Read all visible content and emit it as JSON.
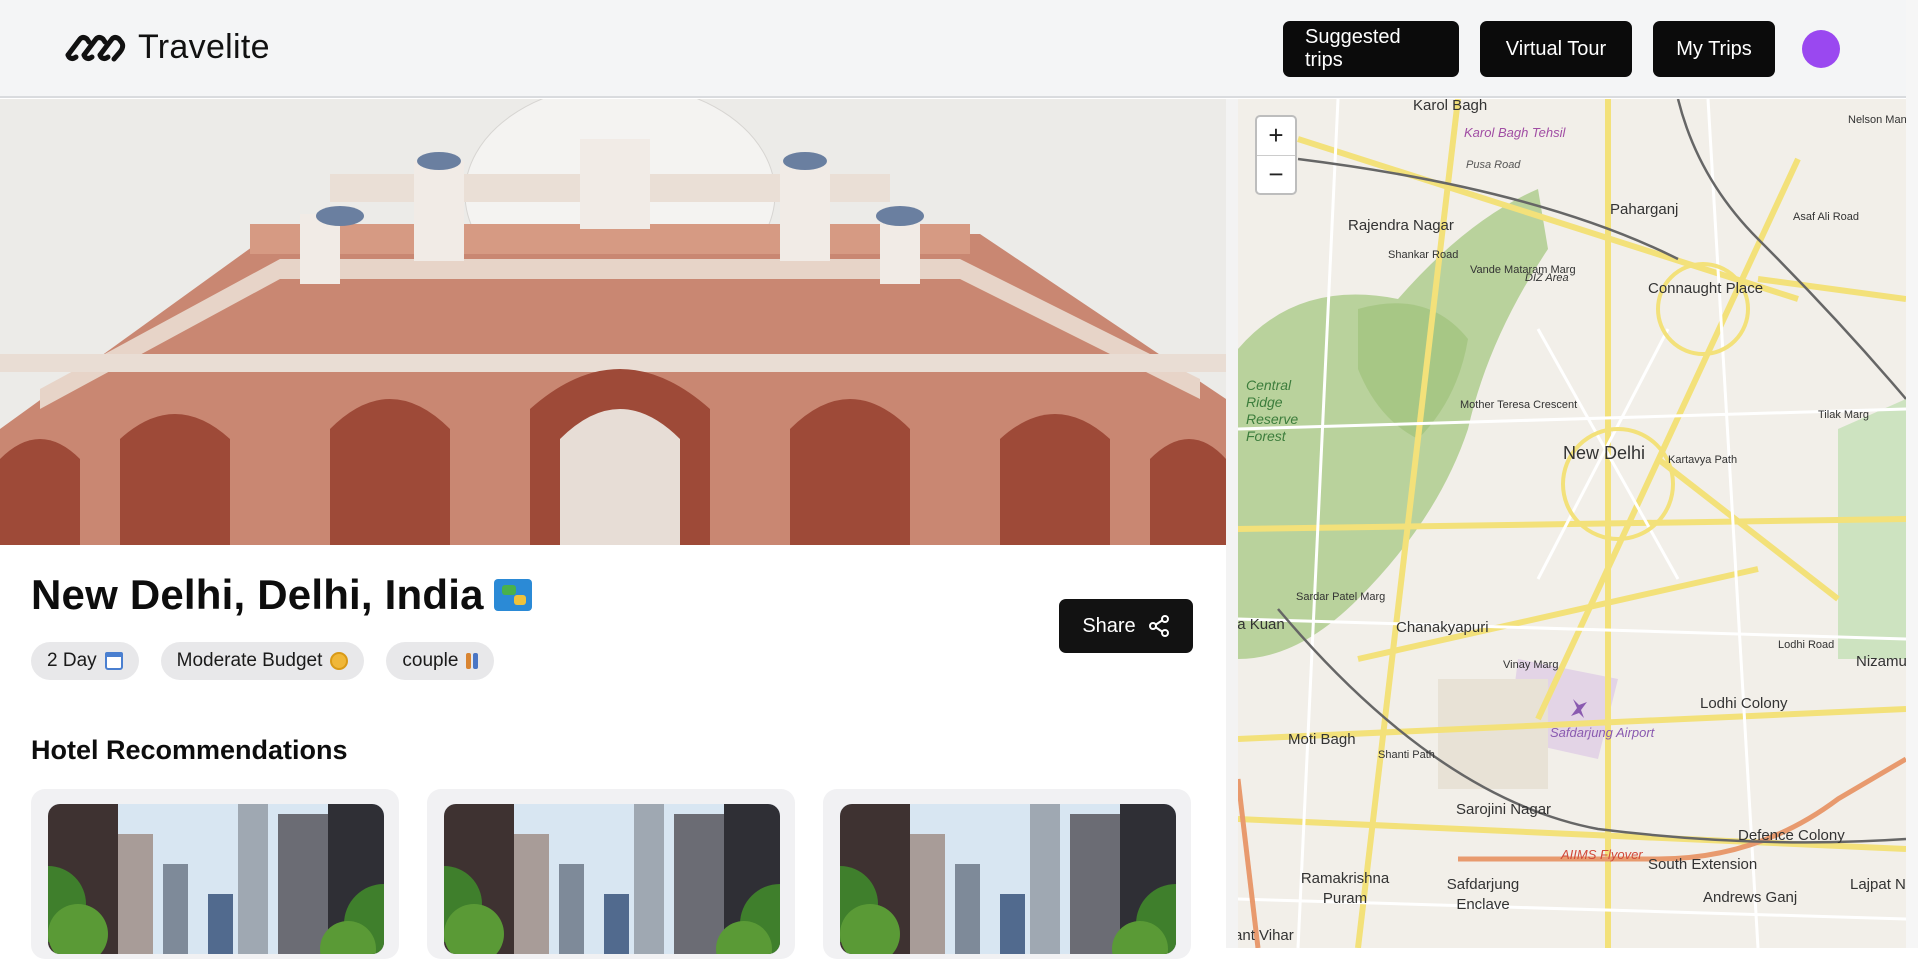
{
  "header": {
    "brand": "Travelite",
    "nav": [
      "Suggested trips",
      "Virtual Tour",
      "My Trips"
    ]
  },
  "trip": {
    "title": "New Delhi, Delhi, India",
    "chips": [
      "2 Day",
      "Moderate Budget",
      "couple"
    ],
    "share_label": "Share"
  },
  "hotels": {
    "section_title": "Hotel Recommendations",
    "cards": [
      {},
      {},
      {}
    ]
  },
  "map": {
    "zoom_in": "+",
    "zoom_out": "−",
    "labels": [
      "Karol Bagh",
      "Karol Bagh Tehsil",
      "Pusa Road",
      "Paharganj",
      "Asaf Ali Road",
      "Rajendra Nagar",
      "Shankar Road",
      "Vande Mataram Marg",
      "DIZ Area",
      "Connaught Place",
      "Central Ridge Reserve Forest",
      "Mother Teresa Crescent",
      "New Delhi",
      "Kartavya Path",
      "Tilak Marg",
      "Sardar Patel Marg",
      "Chanakyapuri",
      "Lodhi Road",
      "Nizamuddin",
      "Lodhi Colony",
      "Safdarjung Airport",
      "Moti Bagh",
      "Shanti Path",
      "Sarojini Nagar",
      "AIIMS Flyover",
      "Defence Colony",
      "South Extension",
      "Ramakrishna Puram",
      "Safdarjung Enclave",
      "Andrews Ganj",
      "Lajpat Nagar",
      "Sant Vihar",
      "Dhaula Kuan",
      "Nelson Mandela Marg",
      "Vinay Marg"
    ]
  },
  "colors": {
    "nav_bg": "#0b0b0b",
    "avatar": "#9a48f0",
    "chip_bg": "#e8e8ea"
  }
}
